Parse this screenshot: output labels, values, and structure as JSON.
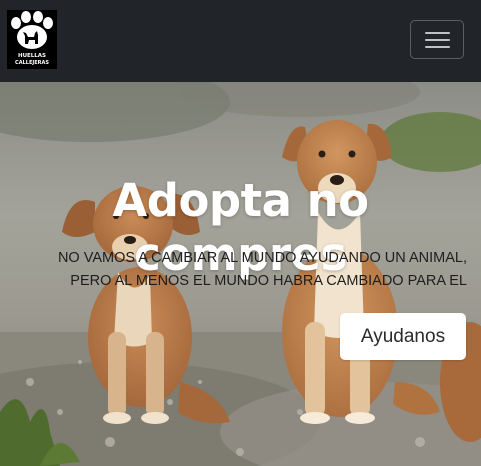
{
  "navbar": {
    "logo": {
      "line1": "HUELLAS",
      "line2": "CALLEJERAS"
    },
    "toggler_icon": "hamburger-icon",
    "background_color": "#212529"
  },
  "hero": {
    "title": "Adopta no compres",
    "text_line1": "NO VAMOS A CAMBIAR AL MUNDO AYUDANDO UN ANIMAL,",
    "text_line2": "PERO AL MENOS EL MUNDO HABRA CAMBIADO PARA EL",
    "button_label": "Ayudanos",
    "background_image": "two-puppies-sitting-on-gravel-photo"
  }
}
